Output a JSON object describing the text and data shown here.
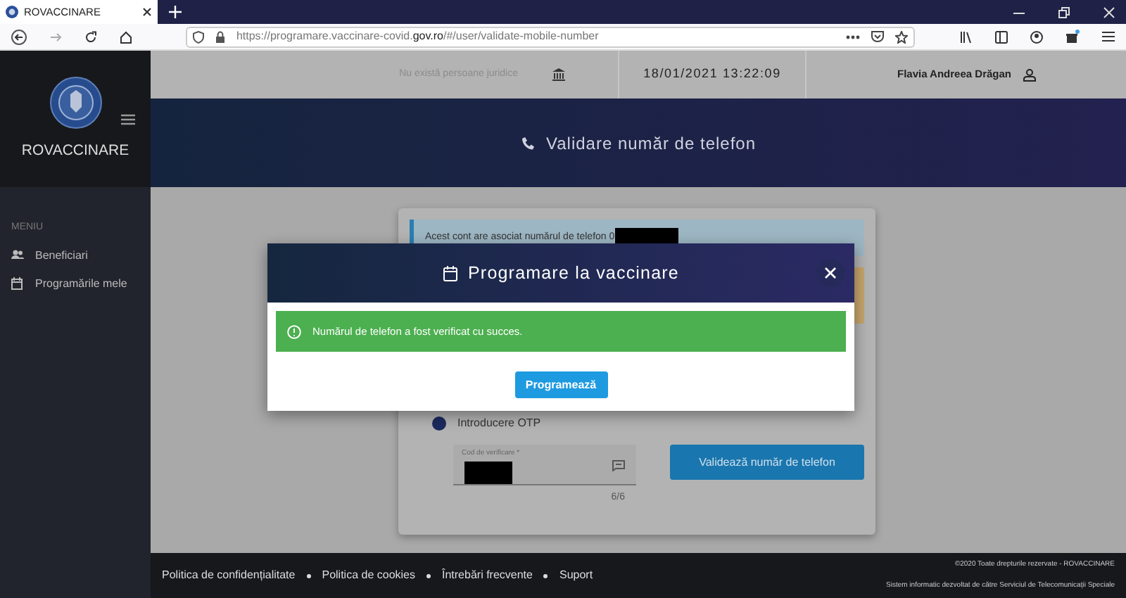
{
  "browser": {
    "tab": {
      "title": "ROVACCINARE",
      "selected": true
    },
    "url": {
      "before": "https://programare.vaccinare-covid.",
      "domain": "gov.ro",
      "after": "/#/user/validate-mobile-number"
    }
  },
  "sidebar": {
    "brand": "ROVACCINARE",
    "menu_heading": "MENIU",
    "items": [
      {
        "label": "Beneficiari",
        "kind": "people"
      },
      {
        "label": "Programările mele",
        "kind": "calendar"
      }
    ]
  },
  "topbar": {
    "legal_entities": "Nu există persoane juridice",
    "datetime": "18/01/2021 13:22:09",
    "user": "Flavia Andreea Drăgan"
  },
  "header": {
    "title": "Validare număr de telefon"
  },
  "card": {
    "info_alert": "Acest cont are asociat numărul de telefon 0",
    "step": {
      "label": "Introducere OTP"
    },
    "field": {
      "label": "Cod de verificare *",
      "counter": "6/6"
    },
    "button": "Validează număr de telefon"
  },
  "modal": {
    "title": "Programare la vaccinare",
    "alert": "Numărul de telefon a fost verificat cu succes.",
    "button": "Programează"
  },
  "footer": {
    "links": [
      "Politica de confidențialitate",
      "Politica de cookies",
      "Întrebări frecvente",
      "Suport"
    ],
    "copyright": "©2020 Toate drepturile rezervate - ROVACCINARE",
    "credit": "Sistem informatic dezvoltat de către Serviciul de Telecomunicații Speciale"
  }
}
